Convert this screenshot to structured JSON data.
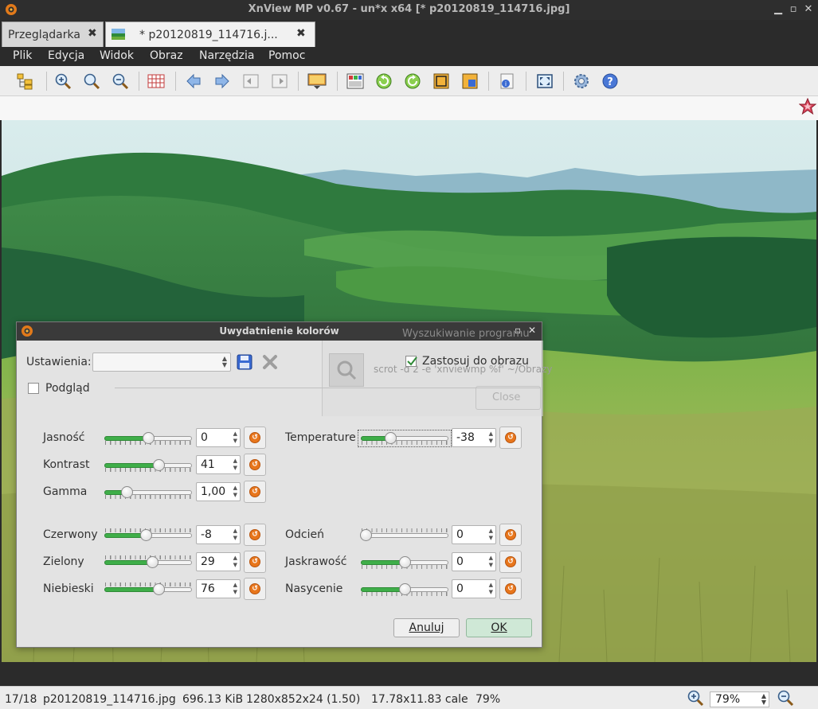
{
  "window": {
    "title": "XnView MP v0.67 - un*x x64 [* p20120819_114716.jpg]"
  },
  "tabs": [
    {
      "label": "Przeglądarka"
    },
    {
      "label": "* p20120819_114716.j..."
    }
  ],
  "menu": {
    "items": [
      "Plik",
      "Edycja",
      "Widok",
      "Obraz",
      "Narzędzia",
      "Pomoc"
    ]
  },
  "toolbar": {
    "icons": [
      "browser-tree-icon",
      "zoom-in-icon",
      "zoom-fit-icon",
      "zoom-out-icon",
      "grid-icon",
      "prev-icon",
      "next-icon",
      "first-icon",
      "last-icon",
      "slideshow-icon",
      "color-adjust-icon",
      "rotate-left-icon",
      "rotate-right-icon",
      "crop-icon",
      "resize-icon",
      "properties-icon",
      "fullscreen-icon",
      "settings-icon",
      "help-icon"
    ]
  },
  "dialog": {
    "title": "Uwydatnienie kolorów",
    "settings_label": "Ustawienia:",
    "apply_label": "Zastosuj do obrazu",
    "apply_checked": true,
    "preview_label": "Podgląd",
    "preview_checked": false,
    "cancel_label": "Anuluj",
    "ok_label": "OK",
    "background_dialog": {
      "title": "Wyszukiwanie programu",
      "field_text": "scrot -d 2 -e 'xnviewmp %f' ~/Obrazy",
      "close_label": "Close"
    },
    "left_sliders": [
      {
        "label": "Jasność",
        "value": "0",
        "level": 0.5
      },
      {
        "label": "Kontrast",
        "value": "41",
        "level": 0.64
      },
      {
        "label": "Gamma",
        "value": "1,00",
        "level": 0.23
      }
    ],
    "right_top_sliders": [
      {
        "label": "Temperature",
        "value": "-38",
        "level": 0.32
      }
    ],
    "color_sliders": [
      {
        "label": "Czerwony",
        "value": "-8",
        "level": 0.47
      },
      {
        "label": "Zielony",
        "value": "29",
        "level": 0.56
      },
      {
        "label": "Niebieski",
        "value": "76",
        "level": 0.64
      }
    ],
    "hsv_sliders": [
      {
        "label": "Odcień",
        "value": "0",
        "level": 0.0
      },
      {
        "label": "Jaskrawość",
        "value": "0",
        "level": 0.5
      },
      {
        "label": "Nasycenie",
        "value": "0",
        "level": 0.5
      }
    ]
  },
  "status": {
    "position": "17/18",
    "filename": "p20120819_114716.jpg",
    "filesize": "696.13 KiB",
    "dimensions": "1280x852x24 (1.50)",
    "print_size": "17.78x11.83 cale",
    "zoom_pct": "79%",
    "zoom_select": "79%"
  },
  "colors": {
    "accent_green": "#3fae49",
    "reset_orange": "#e8761c",
    "ok_button": "#cfe8d6"
  }
}
